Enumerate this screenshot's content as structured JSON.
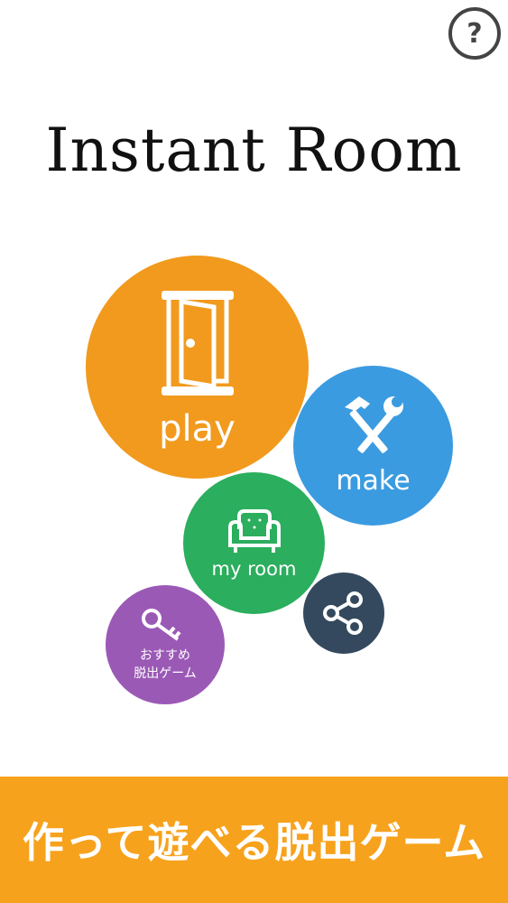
{
  "help": {
    "symbol": "?",
    "icon": "question-circle-icon"
  },
  "app": {
    "title": "Instant Room"
  },
  "menu": {
    "play": {
      "label": "play",
      "icon": "door-icon",
      "color": "#F19A1E"
    },
    "make": {
      "label": "make",
      "icon": "tools-icon",
      "color": "#3B9BE0"
    },
    "my_room": {
      "label": "my room",
      "icon": "armchair-icon",
      "color": "#2BAE5D"
    },
    "share": {
      "icon": "share-icon",
      "color": "#34495E"
    },
    "recommended": {
      "label": "おすすめ\n脱出ゲーム",
      "icon": "key-icon",
      "color": "#9B59B6"
    }
  },
  "banner": {
    "text": "作って遊べる脱出ゲーム",
    "color": "#F7A21C"
  }
}
